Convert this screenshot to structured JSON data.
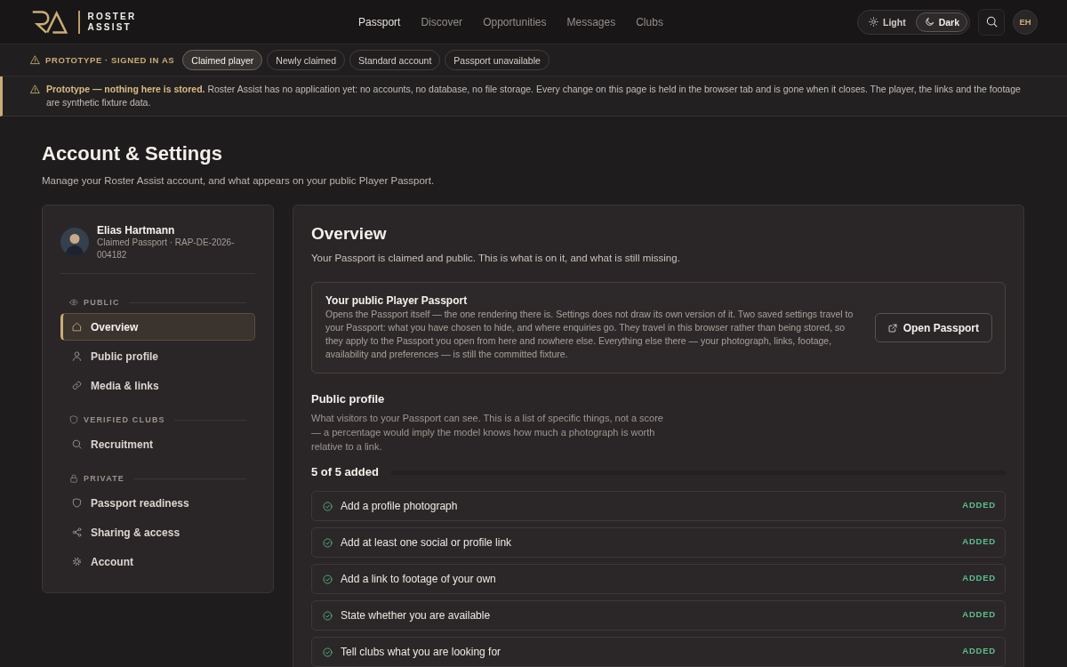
{
  "header": {
    "brand": "ROSTER ASSIST",
    "nav": [
      {
        "label": "Passport",
        "selected": true
      },
      {
        "label": "Discover",
        "selected": false
      },
      {
        "label": "Opportunities",
        "selected": false
      },
      {
        "label": "Messages",
        "selected": false
      },
      {
        "label": "Clubs",
        "selected": false
      }
    ],
    "theme": [
      {
        "label": "Light",
        "selected": false
      },
      {
        "label": "Dark",
        "selected": true
      }
    ],
    "avatar": "EH"
  },
  "prototype_bar": {
    "label": "PROTOTYPE · SIGNED IN AS",
    "roles": [
      {
        "label": "Claimed player",
        "selected": true
      },
      {
        "label": "Newly claimed",
        "selected": false
      },
      {
        "label": "Standard account",
        "selected": false
      },
      {
        "label": "Passport unavailable",
        "selected": false
      }
    ]
  },
  "notice": {
    "text": "**Prototype — nothing here is stored.** Roster Assist has no application yet: no accounts, no database, no file storage. Every change on this page is held in the browser tab and is gone when it closes. The player, the links and the footage are synthetic fixture data."
  },
  "page": {
    "title": "Account & Settings",
    "subtitle": "Manage your Roster Assist account, and what appears on your public Player Passport."
  },
  "sidebar": {
    "profile": {
      "name": "Elias Hartmann",
      "detail": "Claimed Passport · RAP-DE-2026-004182"
    },
    "sections": [
      {
        "label": "PUBLIC",
        "items": [
          {
            "label": "Overview",
            "selected": true
          },
          {
            "label": "Public profile",
            "selected": false
          },
          {
            "label": "Media & links",
            "selected": false
          }
        ]
      },
      {
        "label": "VERIFIED CLUBS",
        "items": [
          {
            "label": "Recruitment",
            "selected": false
          }
        ]
      },
      {
        "label": "PRIVATE",
        "items": [
          {
            "label": "Passport readiness",
            "selected": false
          },
          {
            "label": "Sharing & access",
            "selected": false
          },
          {
            "label": "Account",
            "selected": false
          }
        ]
      }
    ]
  },
  "main": {
    "title": "Overview",
    "intro": "Your Passport is claimed and public. This is what is on it, and what is still missing.",
    "passport_card": {
      "title": "Your public Player Passport",
      "text": "Opens the Passport itself — the one rendering there is. Settings does not draw its own version of it. Two saved settings travel to your Passport: what you have chosen to hide, and where enquiries go. They travel in this browser rather than being stored, so they apply to the Passport you open from here and nowhere else. Everything else there — your photograph, links, footage, availability and preferences — is still the committed fixture.",
      "button": "Open Passport"
    },
    "public_profile": {
      "title": "Public profile",
      "text": "What visitors to your Passport can see. This is a list of specific things, not a score — a percentage would imply the model knows how much a photograph is worth relative to a link.",
      "summary": "5 of 5 added",
      "items": [
        {
          "label": "Add a profile photograph",
          "done": true,
          "status": "ADDED"
        },
        {
          "label": "Add at least one social or profile link",
          "done": true,
          "status": "ADDED"
        },
        {
          "label": "Add a link to footage of your own",
          "done": true,
          "status": "ADDED"
        },
        {
          "label": "State whether you are available",
          "done": true,
          "status": "ADDED"
        },
        {
          "label": "Tell clubs what you are looking for",
          "done": true,
          "status": "ADDED"
        }
      ]
    }
  }
}
